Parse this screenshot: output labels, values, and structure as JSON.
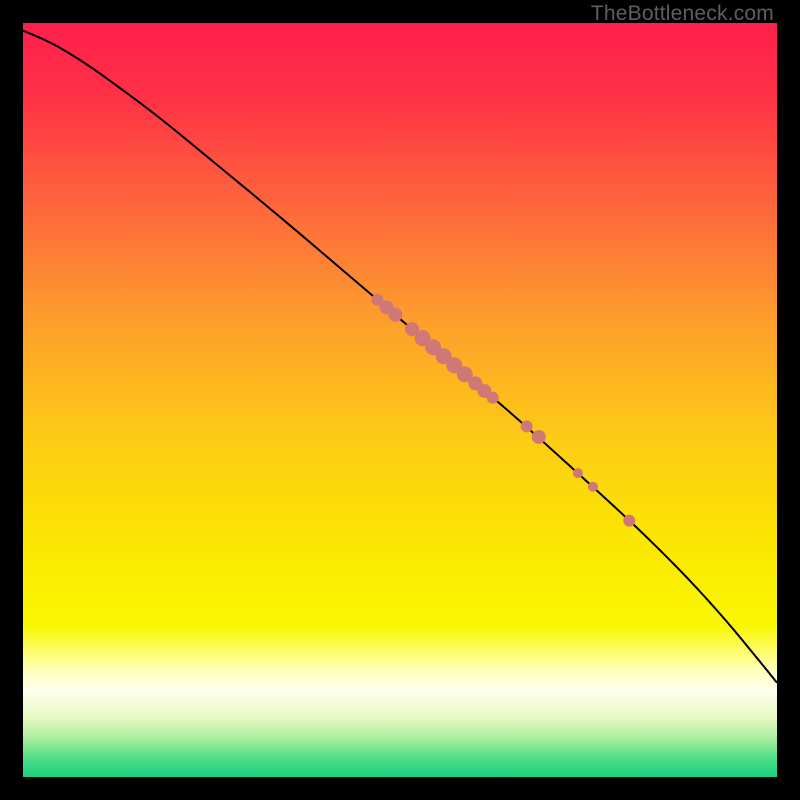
{
  "watermark": "TheBottleneck.com",
  "colors": {
    "dot": "#CF7875",
    "line": "#000000"
  },
  "chart_data": {
    "type": "scatter",
    "title": "",
    "xlabel": "",
    "ylabel": "",
    "xlim": [
      0,
      100
    ],
    "ylim": [
      0,
      100
    ],
    "background_gradient": {
      "stops": [
        {
          "offset": 0.0,
          "color": "#FF1E4B"
        },
        {
          "offset": 0.1,
          "color": "#FF3246"
        },
        {
          "offset": 0.25,
          "color": "#FE693B"
        },
        {
          "offset": 0.4,
          "color": "#FDA02B"
        },
        {
          "offset": 0.55,
          "color": "#FDCB15"
        },
        {
          "offset": 0.68,
          "color": "#FBE502"
        },
        {
          "offset": 0.8,
          "color": "#FAF702"
        },
        {
          "offset": 0.86,
          "color": "#FFFFC0"
        },
        {
          "offset": 0.885,
          "color": "#FFFFF0"
        },
        {
          "offset": 0.92,
          "color": "#E9F9C4"
        },
        {
          "offset": 0.95,
          "color": "#A8EE9D"
        },
        {
          "offset": 0.975,
          "color": "#4FDD87"
        },
        {
          "offset": 1.0,
          "color": "#18D082"
        }
      ]
    },
    "curve": [
      {
        "x": 0.0,
        "y": 99.0
      },
      {
        "x": 4.0,
        "y": 97.2
      },
      {
        "x": 8.0,
        "y": 94.8
      },
      {
        "x": 12.0,
        "y": 92.0
      },
      {
        "x": 18.0,
        "y": 87.5
      },
      {
        "x": 25.0,
        "y": 81.8
      },
      {
        "x": 35.0,
        "y": 73.5
      },
      {
        "x": 45.0,
        "y": 65.0
      },
      {
        "x": 55.0,
        "y": 56.5
      },
      {
        "x": 65.0,
        "y": 48.0
      },
      {
        "x": 75.0,
        "y": 39.0
      },
      {
        "x": 82.0,
        "y": 32.5
      },
      {
        "x": 88.0,
        "y": 26.5
      },
      {
        "x": 93.0,
        "y": 21.0
      },
      {
        "x": 97.0,
        "y": 16.2
      },
      {
        "x": 100.0,
        "y": 12.5
      }
    ],
    "series": [
      {
        "name": "highlighted-points",
        "points": [
          {
            "x": 47.0,
            "y": 63.3,
            "r": 6
          },
          {
            "x": 48.2,
            "y": 62.3,
            "r": 7
          },
          {
            "x": 49.4,
            "y": 61.3,
            "r": 7
          },
          {
            "x": 51.6,
            "y": 59.4,
            "r": 7
          },
          {
            "x": 53.0,
            "y": 58.2,
            "r": 8
          },
          {
            "x": 54.4,
            "y": 57.0,
            "r": 8
          },
          {
            "x": 55.8,
            "y": 55.8,
            "r": 8
          },
          {
            "x": 57.2,
            "y": 54.6,
            "r": 8
          },
          {
            "x": 58.6,
            "y": 53.4,
            "r": 8
          },
          {
            "x": 60.0,
            "y": 52.2,
            "r": 7
          },
          {
            "x": 61.2,
            "y": 51.2,
            "r": 7
          },
          {
            "x": 62.3,
            "y": 50.3,
            "r": 6
          },
          {
            "x": 66.8,
            "y": 46.5,
            "r": 6
          },
          {
            "x": 68.4,
            "y": 45.1,
            "r": 7
          },
          {
            "x": 73.6,
            "y": 40.3,
            "r": 5
          },
          {
            "x": 75.6,
            "y": 38.5,
            "r": 5
          },
          {
            "x": 80.4,
            "y": 34.0,
            "r": 6
          }
        ]
      }
    ]
  }
}
